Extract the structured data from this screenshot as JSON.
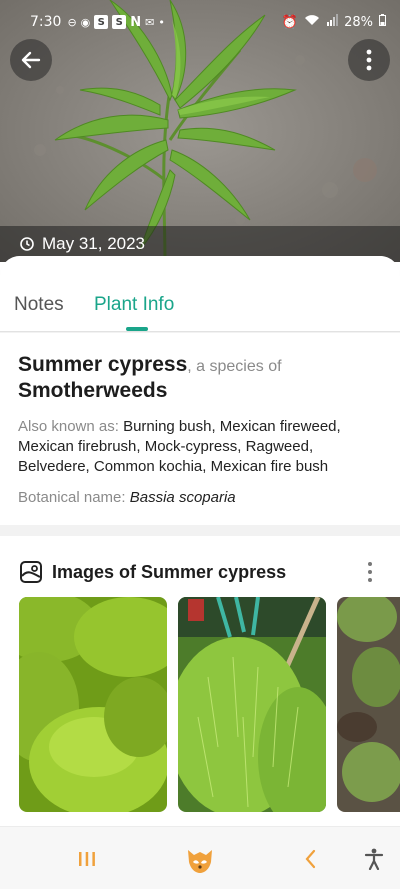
{
  "status_bar": {
    "time": "7:30",
    "notification_letters": [
      "S",
      "S",
      "N"
    ],
    "battery": "28%"
  },
  "hero": {
    "date": "May 31, 2023"
  },
  "tabs": [
    {
      "label": "Notes",
      "active": false
    },
    {
      "label": "Plant Info",
      "active": true
    }
  ],
  "plant": {
    "common_name": "Summer cypress",
    "species_of_text": ", a species of",
    "genus": "Smotherweeds",
    "aka_label": "Also known as:",
    "aka_value": "Burning bush, Mexican fireweed, Mexican firebrush, Mock-cypress, Ragweed, Belvedere, Common kochia, Mexican fire bush",
    "botanical_label": "Botanical name:",
    "botanical_value": "Bassia scoparia"
  },
  "images_section": {
    "title": "Images of Summer cypress"
  },
  "colors": {
    "accent": "#1aa58a",
    "nav_icon": "#f0a13c"
  },
  "icons": {
    "back": "arrow-left-icon",
    "more": "more-vertical-icon",
    "date": "clock-icon",
    "images": "image-gallery-icon",
    "nav_recents": "recents-icon",
    "nav_home": "home-icon",
    "nav_back": "chevron-left-icon",
    "nav_accessibility": "accessibility-icon"
  }
}
